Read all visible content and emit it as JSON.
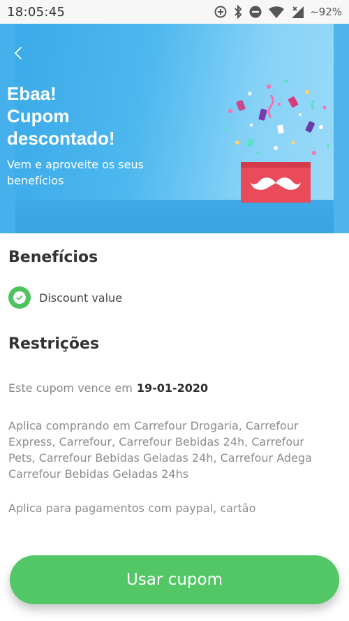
{
  "status_bar": {
    "time": "18:05:45",
    "battery": "~92%",
    "icons": [
      "data-saver-icon",
      "bluetooth-icon",
      "do-not-disturb-icon",
      "wifi-icon",
      "cell-signal-icon"
    ]
  },
  "hero": {
    "back_icon": "chevron-left-icon",
    "title_lines": [
      "Ebaa!",
      "Cupom",
      "descontado!"
    ],
    "subtitle_lines": [
      "Vem e aproveite os seus",
      "benefícios"
    ],
    "illustration": "gift-box-confetti"
  },
  "benefits": {
    "title": "Benefícios",
    "items": [
      {
        "label": "Discount value",
        "icon": "check-circle-icon"
      }
    ]
  },
  "restrictions": {
    "title": "Restrições",
    "expiry_prefix": "Este cupom vence em",
    "expiry_date": "19-01-2020",
    "stores_lines": [
      "Aplica comprando em Carrefour Drogaria, Carrefour",
      "Express, Carrefour, Carrefour Bebidas 24h, Carrefour",
      "Pets, Carrefour Bebidas Geladas 24h, Carrefour Adega",
      "Carrefour Bebidas Geladas 24hs"
    ],
    "payment": "Aplica para pagamentos com paypal, cartão"
  },
  "cta": {
    "label": "Usar cupom"
  },
  "colors": {
    "hero_blue": "#39a9e8",
    "cta_green": "#53c765",
    "check_green": "#4cc35d",
    "gift_red": "#e94b5a"
  }
}
